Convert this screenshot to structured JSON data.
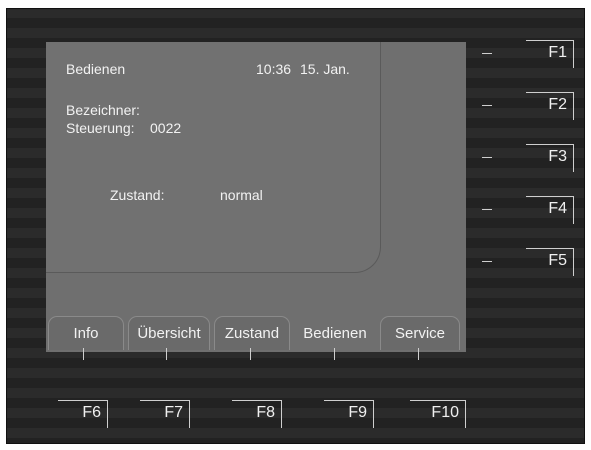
{
  "header": {
    "mode_title": "Bedienen",
    "time": "10:36",
    "date": "15. Jan."
  },
  "info": {
    "bezeichner_label": "Bezeichner:",
    "steuerung_label": "Steuerung:",
    "steuerung_value": "0022",
    "zustand_label": "Zustand:",
    "zustand_value": "normal"
  },
  "tabs": [
    {
      "label": "Info",
      "active": false
    },
    {
      "label": "Übersicht",
      "active": false
    },
    {
      "label": "Zustand",
      "active": false
    },
    {
      "label": "Bedienen",
      "active": true
    },
    {
      "label": "Service",
      "active": false
    }
  ],
  "side_keys": [
    "F1",
    "F2",
    "F3",
    "F4",
    "F5"
  ],
  "bottom_keys": [
    "F6",
    "F7",
    "F8",
    "F9",
    "F10"
  ]
}
